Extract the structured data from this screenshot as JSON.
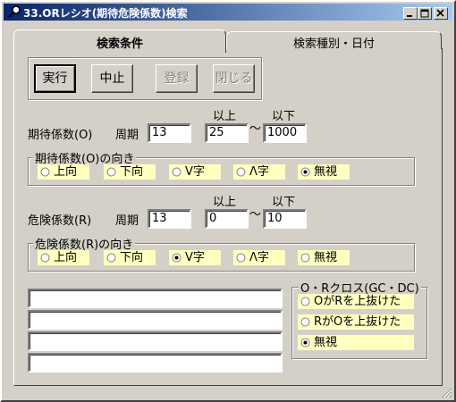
{
  "window": {
    "title": "33.ORレシオ(期待危険係数)検索"
  },
  "tabs": [
    {
      "label": "検索条件",
      "active": true
    },
    {
      "label": "検索種別・日付",
      "active": false
    }
  ],
  "buttons": {
    "run": "実行",
    "stop": "中止",
    "register": "登録",
    "close": "閉じる"
  },
  "expect": {
    "label": "期待係数(O)",
    "period_label": "周期",
    "period_value": "13",
    "min_header": "以上",
    "max_header": "以下",
    "min_value": "25",
    "tilde": "〜",
    "max_value": "1000"
  },
  "expect_direction": {
    "title": "期待係数(O)の向き",
    "options": [
      "上向",
      "下向",
      "V字",
      "Λ字",
      "無視"
    ],
    "selected": "無視"
  },
  "risk": {
    "label": "危険係数(R)",
    "period_label": "周期",
    "period_value": "13",
    "min_header": "以上",
    "max_header": "以下",
    "min_value": "0",
    "tilde": "〜",
    "max_value": "10"
  },
  "risk_direction": {
    "title": "危険係数(R)の向き",
    "options": [
      "上向",
      "下向",
      "V字",
      "Λ字",
      "無視"
    ],
    "selected": "V字"
  },
  "cross": {
    "title": "O・Rクロス(GC・DC)",
    "options": [
      "OがRを上抜けた",
      "RがOを上抜けた",
      "無視"
    ],
    "selected": "無視"
  },
  "colors": {
    "titlebar_start": "#0a246a",
    "titlebar_end": "#a6caf0",
    "option_background": "#ffffc0",
    "face": "#d4d0c8"
  }
}
